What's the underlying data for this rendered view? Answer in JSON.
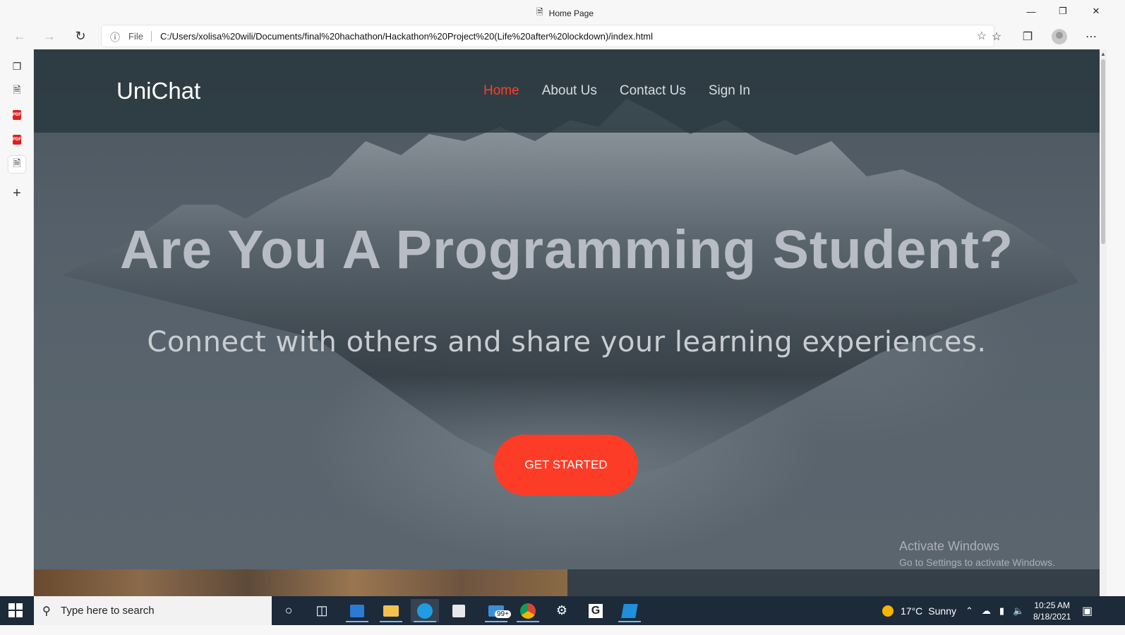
{
  "browser": {
    "tab_title": "Home Page",
    "url_scheme_label": "File",
    "url": "C:/Users/xolisa%20wili/Documents/final%20hachathon/Hackathon%20Project%20(Life%20after%20lockdown)/index.html"
  },
  "site": {
    "logo": "UniChat",
    "nav": [
      {
        "label": "Home",
        "active": true
      },
      {
        "label": "About Us",
        "active": false
      },
      {
        "label": "Contact Us",
        "active": false
      },
      {
        "label": "Sign In",
        "active": false
      }
    ],
    "headline": "Are You A Programming Student?",
    "subheadline": "Connect with others and share your learning experiences.",
    "cta_label": "GET STARTED",
    "accent_color": "#fd3c27"
  },
  "watermark": {
    "line1": "Activate Windows",
    "line2": "Go to Settings to activate Windows."
  },
  "taskbar": {
    "search_placeholder": "Type here to search",
    "mail_badge": "99+",
    "weather_temp": "17°C",
    "weather_text": "Sunny",
    "time": "10:25 AM",
    "date": "8/18/2021"
  }
}
